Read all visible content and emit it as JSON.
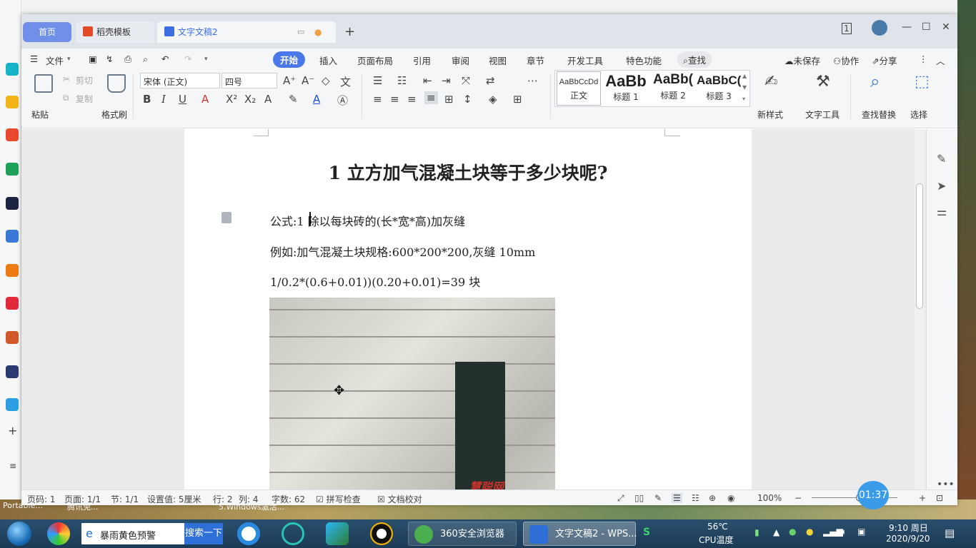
{
  "window": {
    "tabs": {
      "home": "首页",
      "templates": "稻壳模板",
      "doc": "文字文稿2"
    }
  },
  "menu": {
    "file": "文件",
    "items": [
      "开始",
      "插入",
      "页面布局",
      "引用",
      "审阅",
      "视图",
      "章节",
      "开发工具",
      "特色功能"
    ],
    "search": "查找",
    "unsaved": "未保存",
    "collab": "协作",
    "share": "分享"
  },
  "ribbon": {
    "paste": "粘贴",
    "cut": "剪切",
    "copy": "复制",
    "format_painter": "格式刷",
    "font_name": "宋体 (正文)",
    "font_size": "四号",
    "styles": [
      {
        "preview": "AaBbCcDd",
        "label": "正文"
      },
      {
        "preview": "AaBb",
        "label": "标题 1"
      },
      {
        "preview": "AaBb(",
        "label": "标题 2"
      },
      {
        "preview": "AaBbC(",
        "label": "标题 3"
      }
    ],
    "new_style": "新样式",
    "text_tools": "文字工具",
    "find_replace": "查找替换",
    "select": "选择"
  },
  "document": {
    "title": "1 立方加气混凝土块等于多少块呢?",
    "paragraphs": [
      "公式:1 除以每块砖的(长*宽*高)加灰缝",
      "例如:加气混凝土块规格:600*200*200,灰缝 10mm",
      "1/0.2*(0.6+0.01))(0.20+0.01)=39 块"
    ],
    "image_watermark": "慧聪网"
  },
  "status": {
    "page_num": "页码: 1",
    "pages": "页面: 1/1",
    "section": "节: 1/1",
    "setting": "设置值: 5厘米",
    "row": "行: 2",
    "col": "列: 4",
    "word_count": "字数: 62",
    "spell_check": "拼写检查",
    "doc_proof": "文档校对",
    "zoom": "100%"
  },
  "overlay": {
    "timer": "01:37"
  },
  "desktop": {
    "under_labels": [
      "Portable...",
      "腾讯免...",
      "5.Windows激活..."
    ]
  },
  "taskbar": {
    "search_text": "暴雨黄色预警",
    "search_button": "搜索一下",
    "tasks": [
      "360安全浏览器",
      "文字文稿2 - WPS..."
    ],
    "temp": "56℃",
    "temp_label": "CPU温度",
    "time": "9:10 周日",
    "date": "2020/9/20"
  },
  "colors": {
    "accent": "#4a78e8",
    "taskbar": "#1b3a55"
  }
}
